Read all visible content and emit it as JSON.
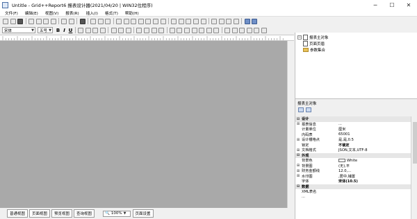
{
  "window": {
    "title": "Untitle - Grid++Report6 报表设计器(2021/04/20 | WIN32位程序)",
    "min_glyph": "─",
    "max_glyph": "☐",
    "close_glyph": "✕"
  },
  "menu": [
    "文件(F)",
    "编辑(E)",
    "视图(V)",
    "报表(R)",
    "插入(I)",
    "格式(T)",
    "帮助(H)"
  ],
  "format_toolbar": {
    "font": "宋体",
    "font_size": "五号",
    "bold": "B",
    "italic": "I",
    "underline": "U"
  },
  "bottom_tabs": [
    "普通视图",
    "页面视图",
    "预览视图",
    "查询视图"
  ],
  "zoom": {
    "value": "100%",
    "icon": "zoom-icon"
  },
  "page_setup_label": "页面设置",
  "object_tree": {
    "root": "报表主对象",
    "children": [
      "页面页眉",
      "参数集合"
    ]
  },
  "properties": {
    "header": "报表主对象",
    "rows": [
      {
        "type": "cat",
        "toggle": "⊟",
        "name": "设计"
      },
      {
        "type": "prop",
        "toggle": "⊞",
        "name": "报表信息",
        "value": "..."
      },
      {
        "type": "prop",
        "toggle": "",
        "name": "计量单位",
        "value": "厘米"
      },
      {
        "type": "prop",
        "toggle": "",
        "name": "内码表",
        "value": "65001"
      },
      {
        "type": "prop",
        "toggle": "⊞",
        "name": "设计栅格点",
        "value": "是,是,0.5"
      },
      {
        "type": "prop",
        "toggle": "",
        "name": "锁定",
        "value": "不锁定",
        "bold": true
      },
      {
        "type": "prop",
        "toggle": "⊞",
        "name": "文档格式",
        "value": "JSON,文本,UTF-8"
      },
      {
        "type": "cat",
        "toggle": "⊟",
        "name": "外观"
      },
      {
        "type": "prop",
        "toggle": "",
        "name": "背景色",
        "value": "White",
        "swatch": true
      },
      {
        "type": "prop",
        "toggle": "⊞",
        "name": "背景图",
        "value": "(无),平"
      },
      {
        "type": "prop",
        "toggle": "⊞",
        "name": "财务金额线",
        "value": "12.0,..."
      },
      {
        "type": "prop",
        "toggle": "⊞",
        "name": "水印图",
        "value": ",居中,铺置"
      },
      {
        "type": "prop",
        "toggle": "",
        "name": "字体",
        "value": "宋体(10.5)",
        "bold": true
      },
      {
        "type": "cat",
        "toggle": "⊟",
        "name": "数据"
      },
      {
        "type": "prop",
        "toggle": "",
        "name": "XML表名",
        "value": ""
      },
      {
        "type": "prop",
        "toggle": "",
        "name": "...",
        "value": ""
      }
    ]
  }
}
